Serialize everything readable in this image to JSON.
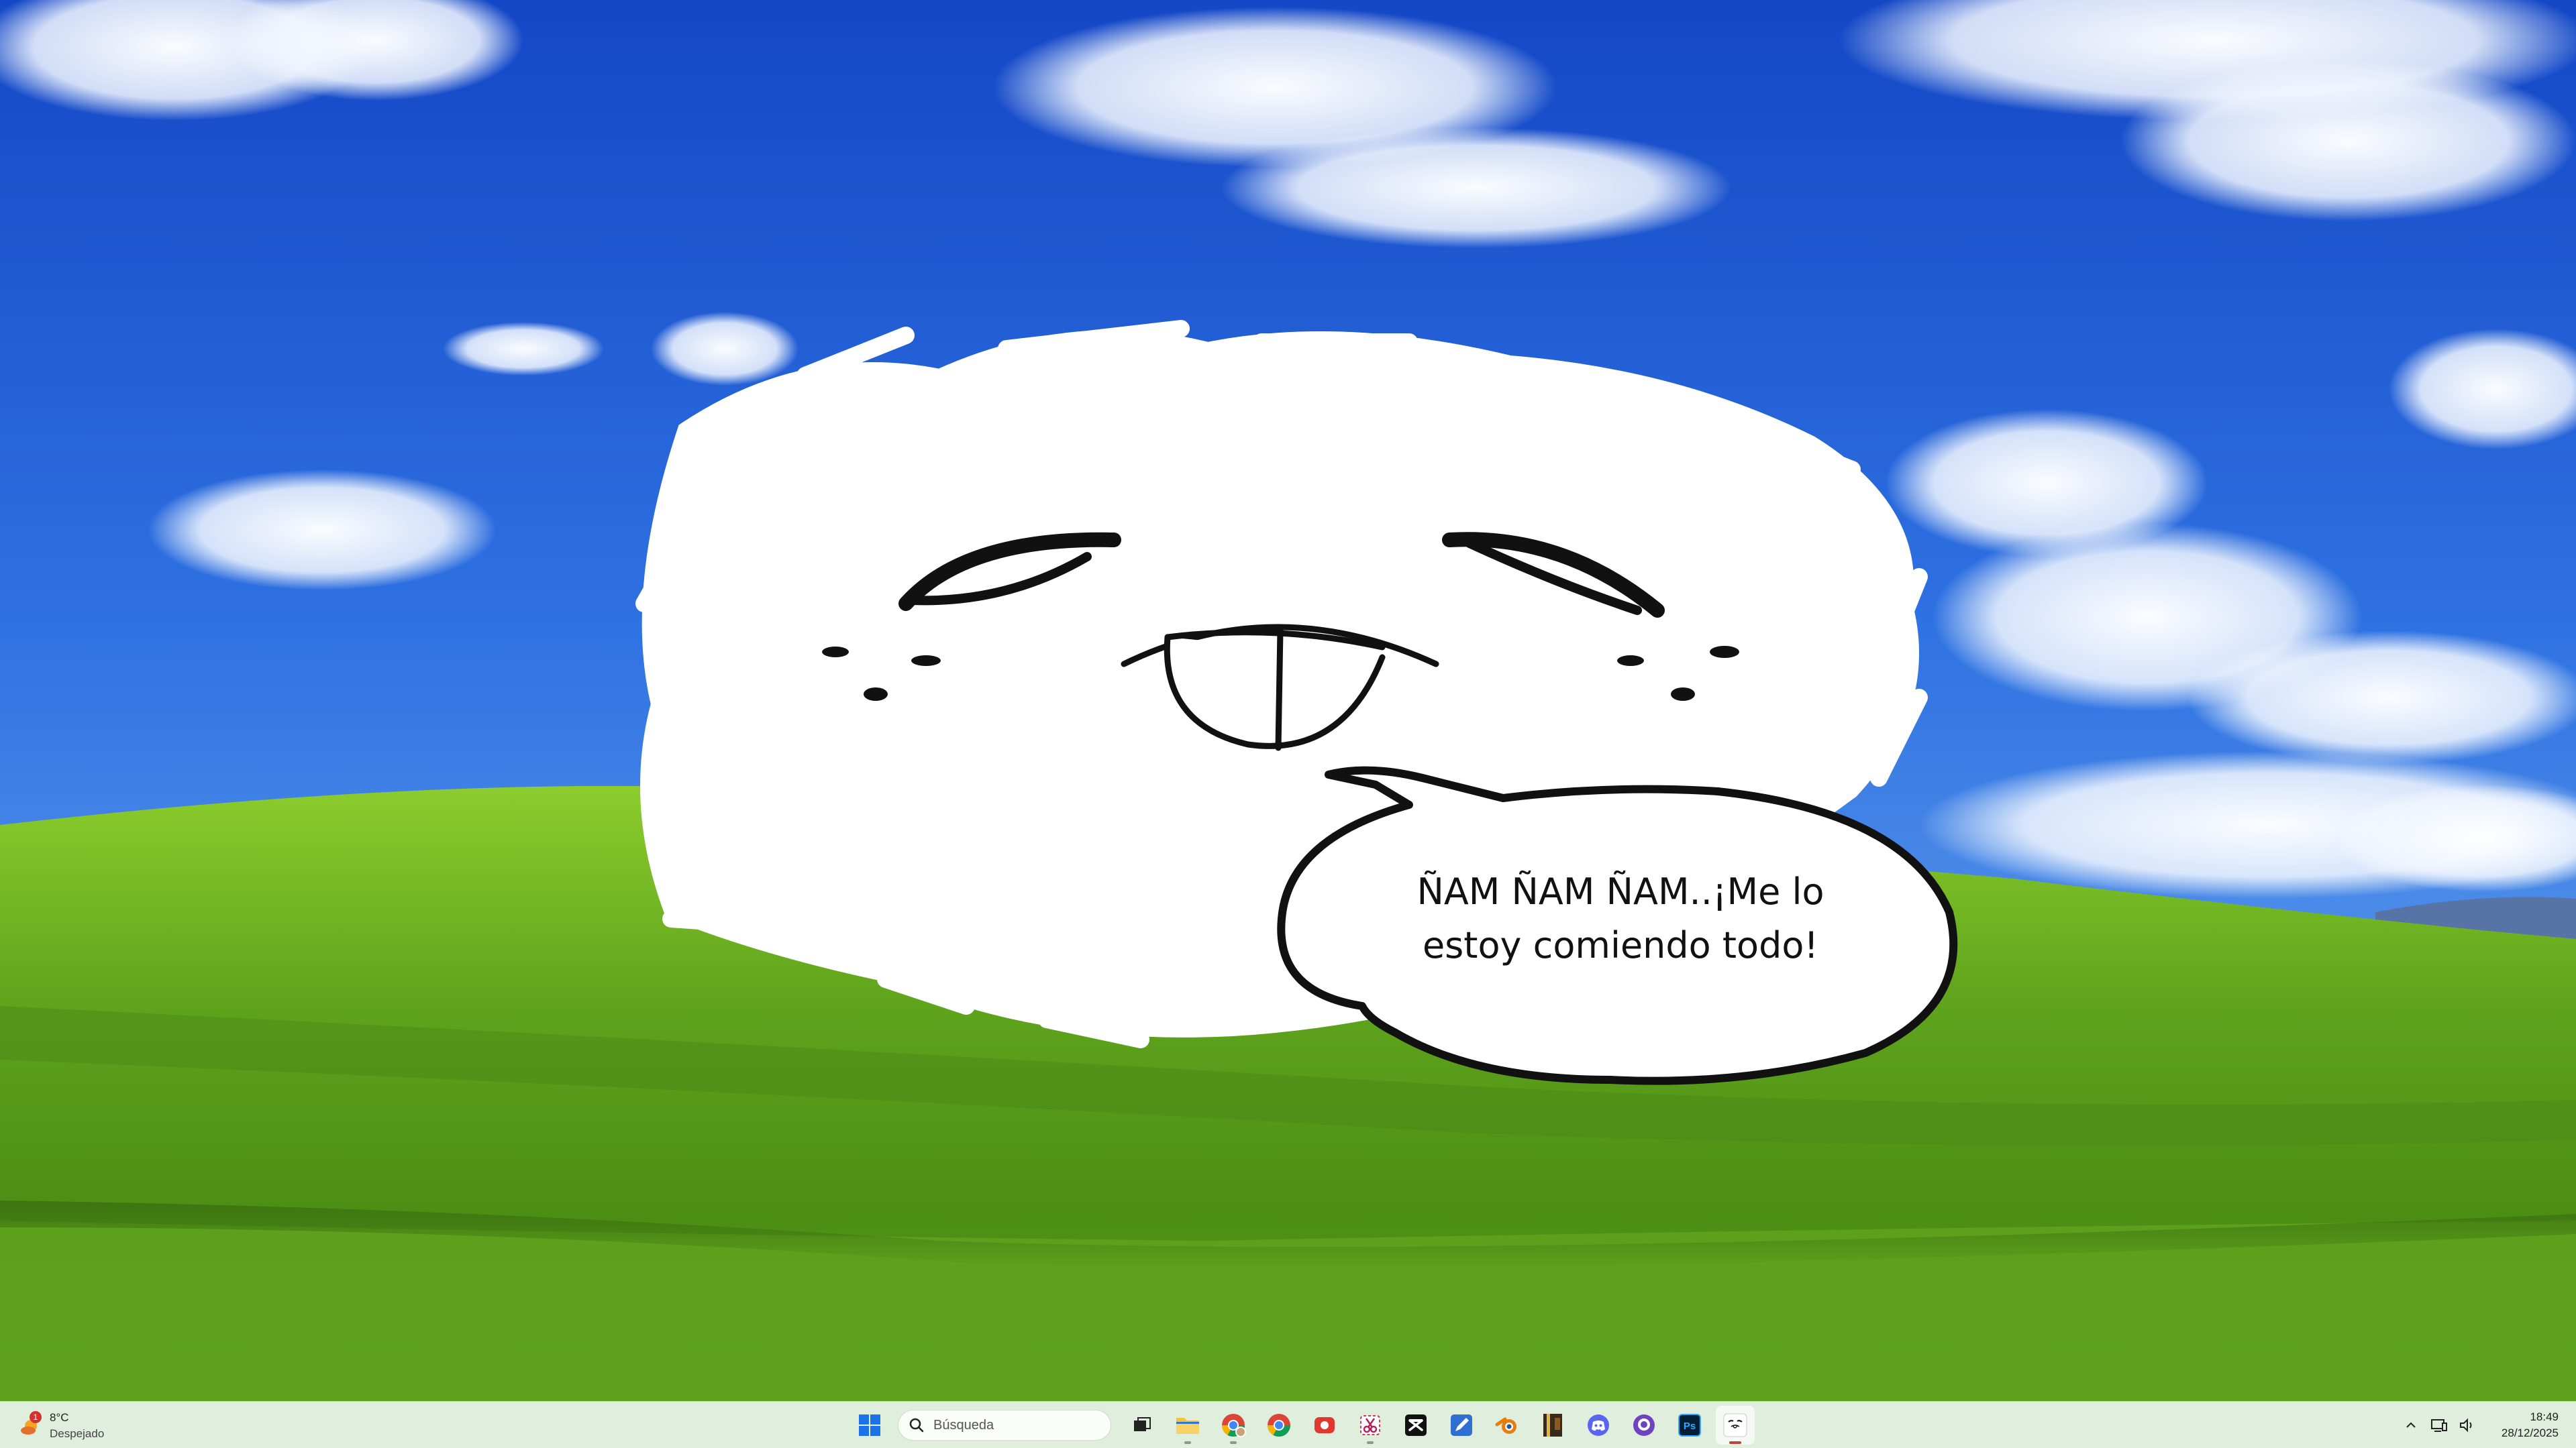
{
  "speech_bubble": {
    "line1": "ÑAM ÑAM ÑAM..¡Me lo",
    "line2": "estoy comiendo todo!"
  },
  "taskbar": {
    "weather": {
      "temperature": "8°C",
      "condition": "Despejado",
      "badge_count": "1",
      "icon": "sun-cloud-icon"
    },
    "search": {
      "placeholder": "Búsqueda"
    },
    "apps": [
      {
        "name": "task-view",
        "icon": "task-view-icon",
        "running": false
      },
      {
        "name": "file-explorer",
        "icon": "folder-icon",
        "running": true
      },
      {
        "name": "chrome-profile",
        "icon": "chrome-icon",
        "running": true
      },
      {
        "name": "chrome",
        "icon": "chrome-icon",
        "running": false
      },
      {
        "name": "screen-recorder",
        "icon": "record-icon",
        "running": false
      },
      {
        "name": "snipping-tool",
        "icon": "scissors-icon",
        "running": true
      },
      {
        "name": "capcut",
        "icon": "capcut-icon",
        "running": false
      },
      {
        "name": "drawing-app",
        "icon": "pen-icon",
        "running": false
      },
      {
        "name": "blender",
        "icon": "blender-icon",
        "running": false
      },
      {
        "name": "archive-tool",
        "icon": "archive-icon",
        "running": false
      },
      {
        "name": "discord",
        "icon": "discord-icon",
        "running": false
      },
      {
        "name": "github-desktop",
        "icon": "github-icon",
        "running": false
      },
      {
        "name": "photoshop",
        "icon": "photoshop-icon",
        "running": false
      },
      {
        "name": "overlay-app",
        "icon": "face-icon",
        "running": true,
        "active": true
      }
    ],
    "photoshop_label": "Ps",
    "clock": {
      "time": "18:49",
      "date": "28/12/2025"
    }
  },
  "colors": {
    "sky_top": "#1c55d6",
    "sky_bottom": "#5fa3f0",
    "grass_light": "#7fc22c",
    "grass_dark": "#3f7a12",
    "taskbar_bg": "#dfeedd"
  }
}
